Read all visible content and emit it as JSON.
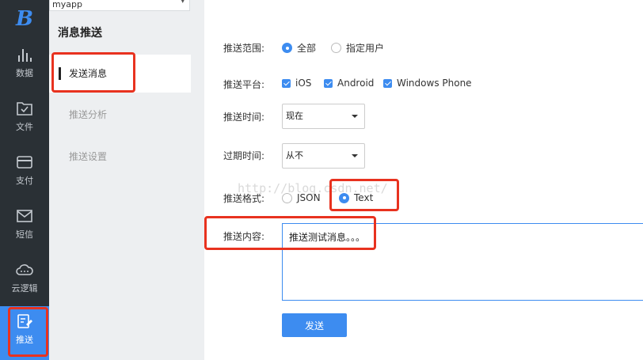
{
  "rail": {
    "logo": "B",
    "items": [
      {
        "label": "数据",
        "icon": "bar-chart-icon"
      },
      {
        "label": "文件",
        "icon": "folder-check-icon"
      },
      {
        "label": "支付",
        "icon": "credit-card-icon"
      },
      {
        "label": "短信",
        "icon": "envelope-icon"
      },
      {
        "label": "云逻辑",
        "icon": "cloud-icon"
      },
      {
        "label": "推送",
        "icon": "edit-push-icon"
      }
    ],
    "active": "推送"
  },
  "app_select": {
    "value": "myapp"
  },
  "sidebar": {
    "title": "消息推送",
    "items": [
      {
        "label": "发送消息"
      },
      {
        "label": "推送分析"
      },
      {
        "label": "推送设置"
      }
    ]
  },
  "form": {
    "scope": {
      "label": "推送范围:",
      "options": [
        "全部",
        "指定用户"
      ],
      "selected": "全部"
    },
    "platform": {
      "label": "推送平台:",
      "options": [
        "iOS",
        "Android",
        "Windows Phone"
      ],
      "checked": [
        "iOS",
        "Android",
        "Windows Phone"
      ]
    },
    "time": {
      "label": "推送时间:",
      "value": "现在"
    },
    "expire": {
      "label": "过期时间:",
      "value": "从不"
    },
    "format": {
      "label": "推送格式:",
      "options": [
        "JSON",
        "Text"
      ],
      "selected": "Text"
    },
    "content": {
      "label": "推送内容:",
      "value": "推送测试消息。。。"
    },
    "send_label": "发送"
  },
  "watermark": "http://blog.csdn.net/",
  "colors": {
    "accent": "#3d8cf0",
    "highlight": "#e8321f",
    "rail": "#2a3035"
  }
}
